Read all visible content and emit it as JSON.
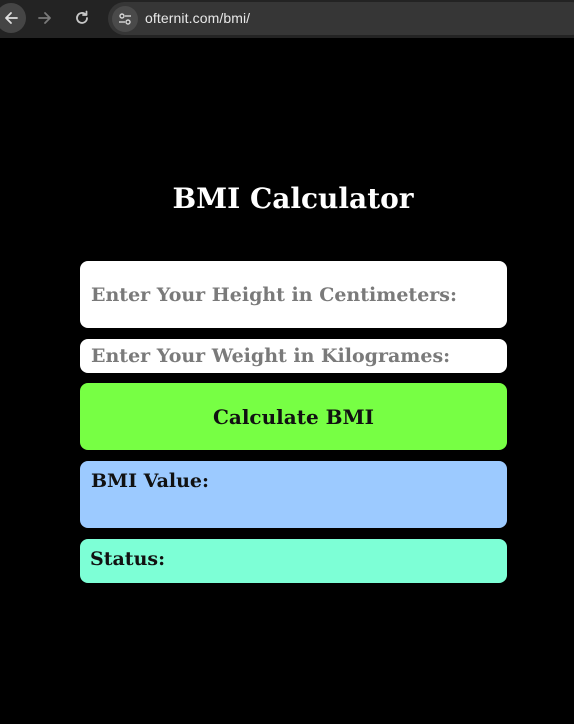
{
  "browser": {
    "url": "ofternit.com/bmi/",
    "back_icon": "arrow-left-icon",
    "forward_icon": "arrow-right-icon",
    "reload_icon": "reload-icon",
    "site_info_icon": "tune-icon"
  },
  "page": {
    "title": "BMI Calculator",
    "height_placeholder": "Enter Your Height in Centimeters:",
    "weight_placeholder": "Enter Your Weight in Kilogrames:",
    "calculate_label": "Calculate BMI",
    "bmi_value_label": "BMI Value:",
    "status_label": "Status:"
  },
  "colors": {
    "background": "#000000",
    "calculate_button": "#77ff44",
    "result_box": "#9ccaff",
    "status_box": "#7dffd6"
  }
}
